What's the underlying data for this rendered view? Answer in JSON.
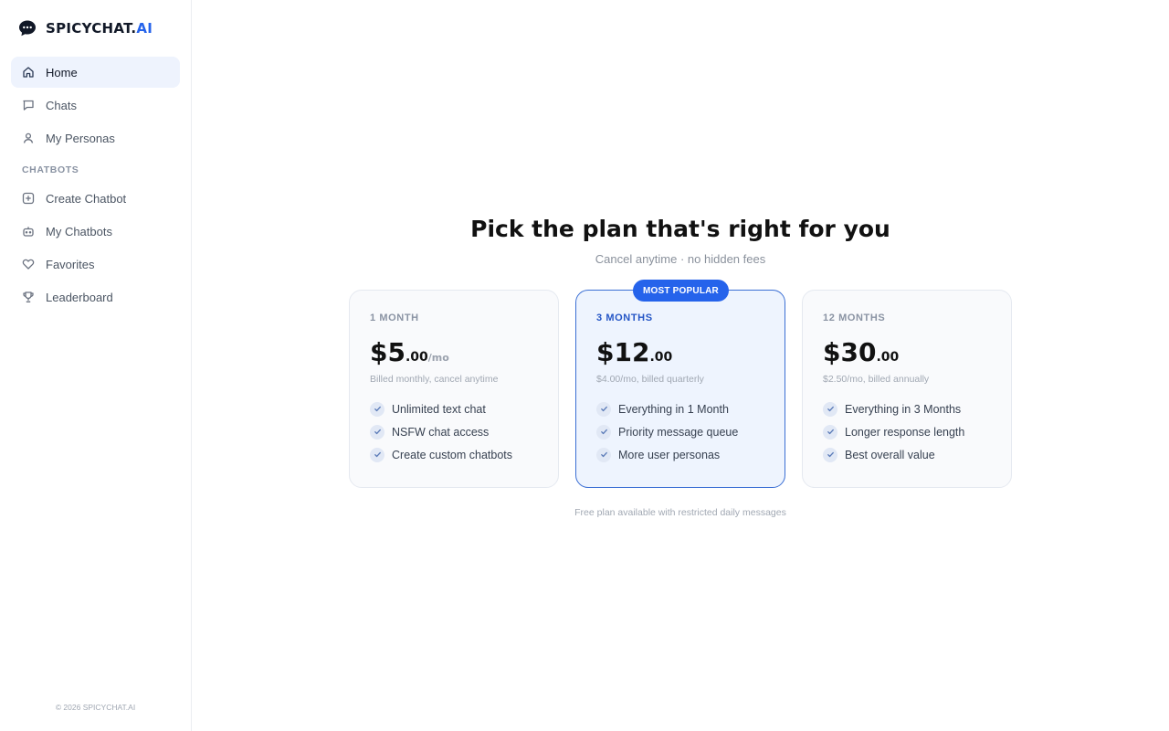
{
  "brand": {
    "name_main": "SPICYCHAT.",
    "name_accent": "AI",
    "icon": "chat-bubble-icon",
    "accent_color": "#2563eb"
  },
  "sidebar": {
    "items": [
      {
        "label": "Home",
        "icon": "home-icon",
        "active": true
      },
      {
        "label": "Chats",
        "icon": "chat-icon"
      },
      {
        "label": "My Personas",
        "icon": "user-icon"
      }
    ],
    "section_label": "CHATBOTS",
    "chatbot_items": [
      {
        "label": "Create Chatbot",
        "icon": "plus-square-icon"
      },
      {
        "label": "My Chatbots",
        "icon": "bot-icon"
      },
      {
        "label": "Favorites",
        "icon": "heart-icon"
      },
      {
        "label": "Leaderboard",
        "icon": "trophy-icon"
      }
    ],
    "copyright": "© 2026 SPICYCHAT.AI"
  },
  "main": {
    "title": "Pick the plan that's right for you",
    "subtitle": "Cancel anytime · no hidden fees",
    "plans": [
      {
        "name": "1 MONTH",
        "price_whole": "$5",
        "price_cents": ".00",
        "price_period": "/mo",
        "billing": "Billed monthly, cancel anytime",
        "features": [
          "Unlimited text chat",
          "NSFW chat access",
          "Create custom chatbots"
        ]
      },
      {
        "name": "3 MONTHS",
        "badge": "MOST POPULAR",
        "price_whole": "$12",
        "price_cents": ".00",
        "billing": "$4.00/mo, billed quarterly",
        "features": [
          "Everything in 1 Month",
          "Priority message queue",
          "More user personas"
        ]
      },
      {
        "name": "12 MONTHS",
        "price_whole": "$30",
        "price_cents": ".00",
        "billing": "$2.50/mo, billed annually",
        "features": [
          "Everything in 3 Months",
          "Longer response length",
          "Best overall value"
        ]
      }
    ],
    "footnote": "Free plan available with restricted daily messages"
  }
}
